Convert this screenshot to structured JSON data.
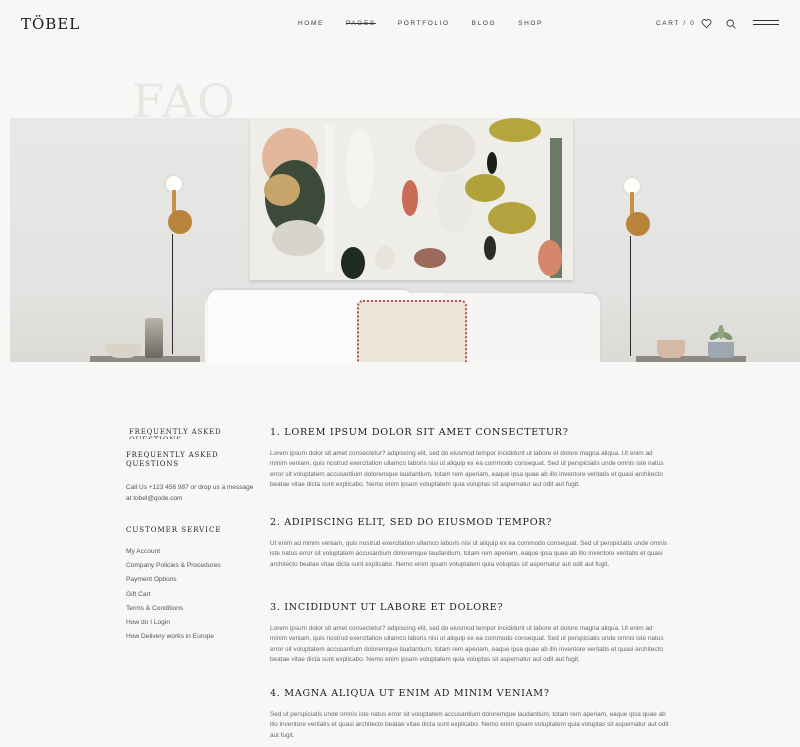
{
  "header": {
    "logo": "TÖBEL",
    "nav": [
      "HOME",
      "PAGES",
      "PORTFOLIO",
      "BLOG",
      "SHOP"
    ],
    "cart": "CART / 0"
  },
  "hero": {
    "title": "FAQ"
  },
  "sidebar": {
    "faded_title": "FREQUENTLY ASKED QUESTIONS",
    "title": "FREQUENTLY ASKED QUESTIONS",
    "contact_prefix": "Call Us ",
    "phone": "+123 456 987",
    "contact_middle": " or drop us a message at ",
    "email": "tobel@qode.com",
    "service_heading": "CUSTOMER SERVICE",
    "links": [
      "My Account",
      "Company Policies & Procedures",
      "Payment Options",
      "Gift Cart",
      "Terms & Conditions",
      "How do I Login",
      "How Delivery works in Europe"
    ]
  },
  "faq": [
    {
      "question": "1. LOREM IPSUM DOLOR SIT AMET CONSECTETUR?",
      "answer": "Lorem ipsum dolor sit amet consectetur? adipiscing elit, sed do eiusmod tempor incididunt ut labore et dolore magna aliqua. Ut enim ad minim veniam, quis nostrud exercitation ullamco laboris nisi ut aliquip ex ea commodo consequat. Sed ut perspiciatis unde omnis iste natus error sit voluptatem accusantium doloremque laudantium, totam rem aperiam, eaque ipsa quae ab illo inventore veritatis et quasi architecto beatae vitae dicta sunt explicabo. Nemo enim ipsam voluptatem quia voluptas sit aspernatur aut odit aut fugit."
    },
    {
      "question": "2. ADIPISCING ELIT, SED DO EIUSMOD TEMPOR?",
      "answer": "Ut enim ad minim veniam, quis nostrud exercitation ullamco laboris nisi ut aliquip ex ea commodo consequat. Sed ut perspiciatis unde omnis iste natus error sit voluptatem accusantium doloremque laudantium, totam rem aperiam, eaque ipsa quae ab illo inventore veritatis et quasi architecto beatae vitae dicta sunt explicabo. Nemo enim ipsam voluptatem quia voluptas sit aspernatur aut odit aut fugit."
    },
    {
      "question": "3. INCIDIDUNT UT LABORE ET DOLORE?",
      "answer": "Lorem ipsum dolor sit amet consectetur? adipiscing elit, sed do eiusmod tempor incididunt ut labore et dolore magna aliqua. Ut enim ad minim veniam, quis nostrud exercitation ullamco laboris nisi ut aliquip ex ea commodo consequat. Sed ut perspiciatis unde omnis iste natus error sit voluptatem accusantium doloremque laudantium, totam rem aperiam, eaque ipsa quae ab illo inventore veritatis et quasi architecto beatae vitae dicta sunt explicabo. Nemo enim ipsam voluptatem quia voluptas sit aspernatur aut odit aut fugit."
    },
    {
      "question": "4. MAGNA ALIQUA UT ENIM AD MINIM VENIAM?",
      "answer": "Sed ut perspiciatis unde omnis iste natus error sit voluptatem accusantium doloremque laudantium, totam rem aperiam, eaque ipsa quae ab illo inventore veritatis et quasi architecto beatae vitae dicta sunt explicabo. Nemo enim ipsam voluptatem quia voluptas sit aspernatur aut odit aut fugit."
    }
  ],
  "colors": {
    "background": "#f7f7f5",
    "heading": "#1a1a1a",
    "body_text": "#6a6a6a",
    "brass": "#b8843c"
  },
  "icons": [
    "heart-icon",
    "search-icon",
    "menu-icon"
  ]
}
